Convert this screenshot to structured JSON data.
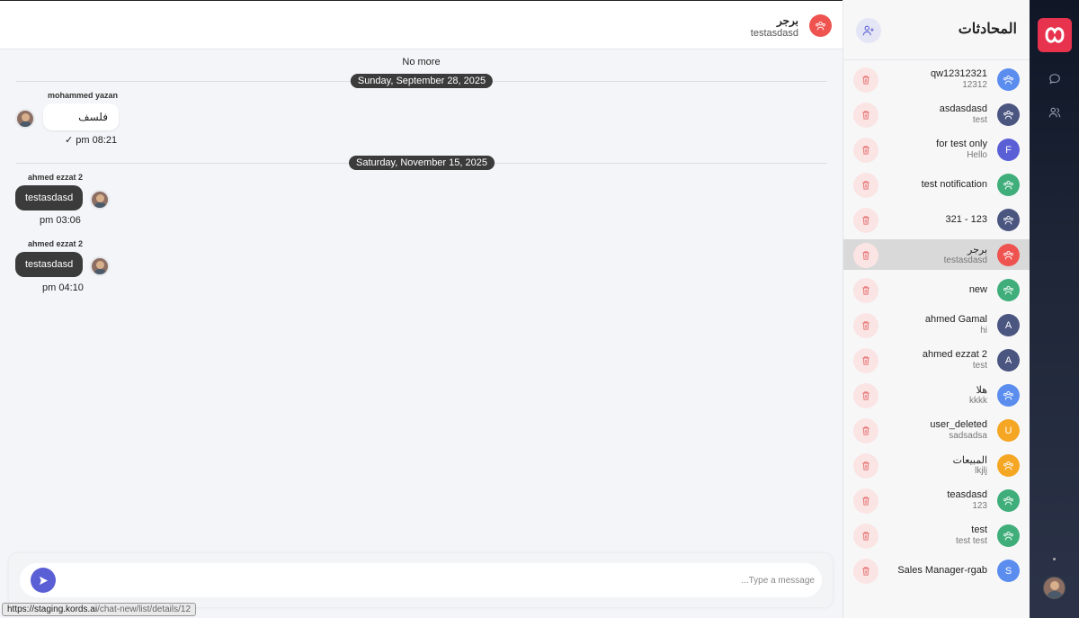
{
  "chat": {
    "header": {
      "title": "برجر",
      "subtitle": "testasdasd",
      "avatar_color": "#ef5350"
    },
    "no_more": "No more",
    "dates": [
      "Sunday, September 28, 2025",
      "Saturday, November 15, 2025"
    ],
    "messages": [
      {
        "sender": "mohammed yazan",
        "text": "فلسف",
        "time": "pm 08:21",
        "check": "✓",
        "direction": "incoming"
      },
      {
        "sender": "ahmed ezzat 2",
        "text": "testasdasd",
        "time": "pm 03:06",
        "direction": "outgoing"
      },
      {
        "sender": "ahmed ezzat 2",
        "text": "testasdasd",
        "time": "pm 04:10",
        "direction": "outgoing"
      }
    ],
    "composer": {
      "placeholder": "...Type a message",
      "send_icon": "send-icon"
    }
  },
  "status_bar": {
    "url_main": "https://staging.kords.ai",
    "url_rest": "/chat-new/list/details/12"
  },
  "conversations": {
    "title": "المحادثات",
    "items": [
      {
        "name": "qw12312321",
        "sub": "12312",
        "avatar": "group",
        "color": "#5b8def"
      },
      {
        "name": "asdasdasd",
        "sub": "test",
        "avatar": "group",
        "color": "#4a5580"
      },
      {
        "name": "for test only",
        "sub": "Hello",
        "avatar": "F",
        "color": "#5b5fd6"
      },
      {
        "name": "test notification",
        "sub": "",
        "avatar": "group",
        "color": "#3fae7a"
      },
      {
        "name": "321 - 123",
        "sub": "",
        "avatar": "group",
        "color": "#4a5580"
      },
      {
        "name": "برجر",
        "sub": "testasdasd",
        "avatar": "group",
        "color": "#ef5350",
        "active": true
      },
      {
        "name": "new",
        "sub": "",
        "avatar": "group",
        "color": "#3fae7a"
      },
      {
        "name": "ahmed Gamal",
        "sub": "hi",
        "avatar": "A",
        "color": "#4a5580"
      },
      {
        "name": "ahmed ezzat 2",
        "sub": "test",
        "avatar": "A",
        "color": "#4a5580"
      },
      {
        "name": "هلا",
        "sub": "kkkk",
        "avatar": "group",
        "color": "#5b8def"
      },
      {
        "name": "user_deleted",
        "sub": "sadsadsa",
        "avatar": "U",
        "color": "#f5a623"
      },
      {
        "name": "المبيعات",
        "sub": "lkjlj",
        "avatar": "group",
        "color": "#f5a623"
      },
      {
        "name": "teasdasd",
        "sub": "123",
        "avatar": "group",
        "color": "#3fae7a"
      },
      {
        "name": "test",
        "sub": "test test",
        "avatar": "group",
        "color": "#3fae7a"
      },
      {
        "name": "Sales Manager-rgab",
        "sub": "",
        "avatar": "S",
        "color": "#5b8def"
      }
    ]
  },
  "rail": {
    "logo_color": "#e8334f",
    "icons": [
      "chat-bubble-icon",
      "users-icon"
    ]
  }
}
